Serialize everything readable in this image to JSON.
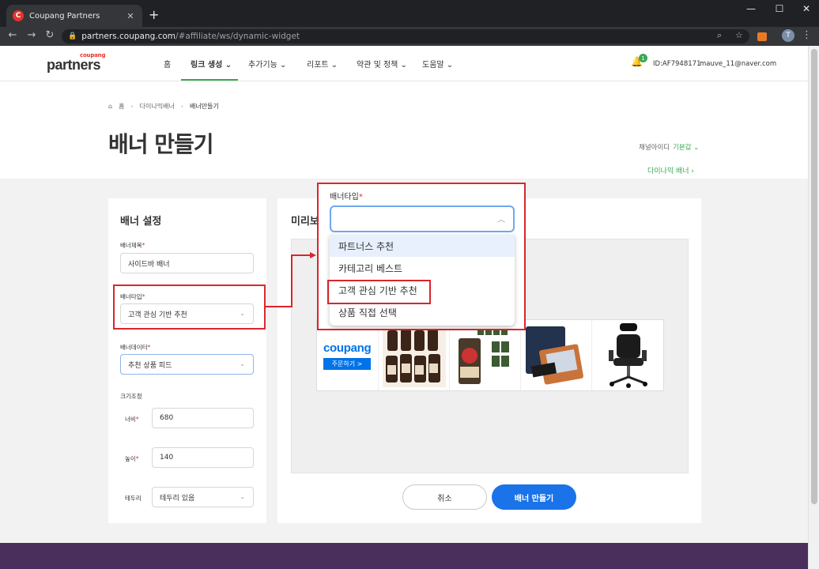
{
  "browser": {
    "tab_title": "Coupang Partners",
    "favicon_letter": "C",
    "url_host": "partners.coupang.com",
    "url_path": "/#affiliate/ws/dynamic-widget",
    "profile_initial": "T",
    "icons": [
      "back-icon",
      "forward-icon",
      "reload-icon",
      "lock-icon",
      "search-icon",
      "star-icon",
      "extension-icon",
      "menu-icon"
    ]
  },
  "header": {
    "logo_small": "coupang",
    "logo_main": "partners",
    "nav": [
      "홈",
      "링크 생성",
      "추가기능",
      "리포트",
      "약관 및 정책",
      "도움말"
    ],
    "notification_count": "1",
    "user_id": "ID:AF7948171",
    "email": "mauve_11@naver.com"
  },
  "breadcrumb": [
    "홈",
    "다이나믹배너",
    "배너만들기"
  ],
  "page_title": "배너 만들기",
  "channel_label": "채널아이디",
  "channel_value": "기본값",
  "dynamic_banner_link": "다이나믹 배너",
  "settings": {
    "title": "배너 설정",
    "banner_title_label": "배너제목",
    "banner_title_value": "사이드바 배너",
    "banner_type_label": "배너타입",
    "banner_type_value": "고객 관심 기반 추천",
    "banner_data_label": "배너데이터",
    "banner_data_value": "추천 상품 피드",
    "size_label": "크기조정",
    "width_label": "너비",
    "width_value": "680",
    "height_label": "높이",
    "height_value": "140",
    "border_label": "테두리",
    "border_value": "테두리 있음"
  },
  "preview": {
    "title": "미리보",
    "banner_brand": "coupang",
    "banner_order": "주문하기 >"
  },
  "buttons": {
    "cancel": "취소",
    "create": "배너 만들기"
  },
  "dropdown": {
    "label": "배너타입",
    "options": [
      "파트너스 추천",
      "카테고리 베스트",
      "고객 관심 기반 추천",
      "상품 직접 선택"
    ]
  },
  "colors": {
    "accent_green": "#3aa853",
    "primary_blue": "#1a73e8",
    "highlight_red": "#d9262c",
    "footer_purple": "#4a2f5c"
  }
}
